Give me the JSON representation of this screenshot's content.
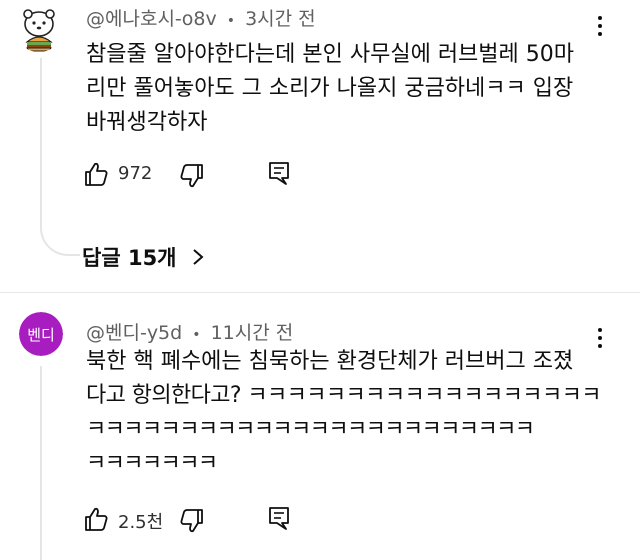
{
  "comments": [
    {
      "author": "@에나호시-o8v",
      "time": "3시간 전",
      "lines": [
        "참을줄 알아야한다는데 본인 사무실에 러브벌레 50마",
        "리만 풀어놓아도 그 소리가 나올지 궁금하네ㅋㅋ 입장",
        "바꿔생각하자"
      ],
      "likes": "972",
      "replies_label": "답글 15개"
    },
    {
      "author": "@벤디-y5d",
      "time": "11시간 전",
      "avatar_text": "벤디",
      "avatar_color": "#a81dbf",
      "lines": [
        "북한 핵 폐수에는 침묵하는 환경단체가 러브버그 조졌",
        "다고 항의한다고? ㅋㅋㅋㅋㅋㅋㅋㅋㅋㅋㅋㅋㅋㅋㅋㅋㅋㅋ",
        "ㅋㅋㅋㅋㅋㅋㅋㅋㅋㅋㅋㅋㅋㅋㅋㅋㅋㅋㅋㅋㅋㅋㅋㅋ",
        "ㅋㅋㅋㅋㅋㅋㅋ"
      ],
      "likes": "2.5천"
    }
  ],
  "separator": "•"
}
